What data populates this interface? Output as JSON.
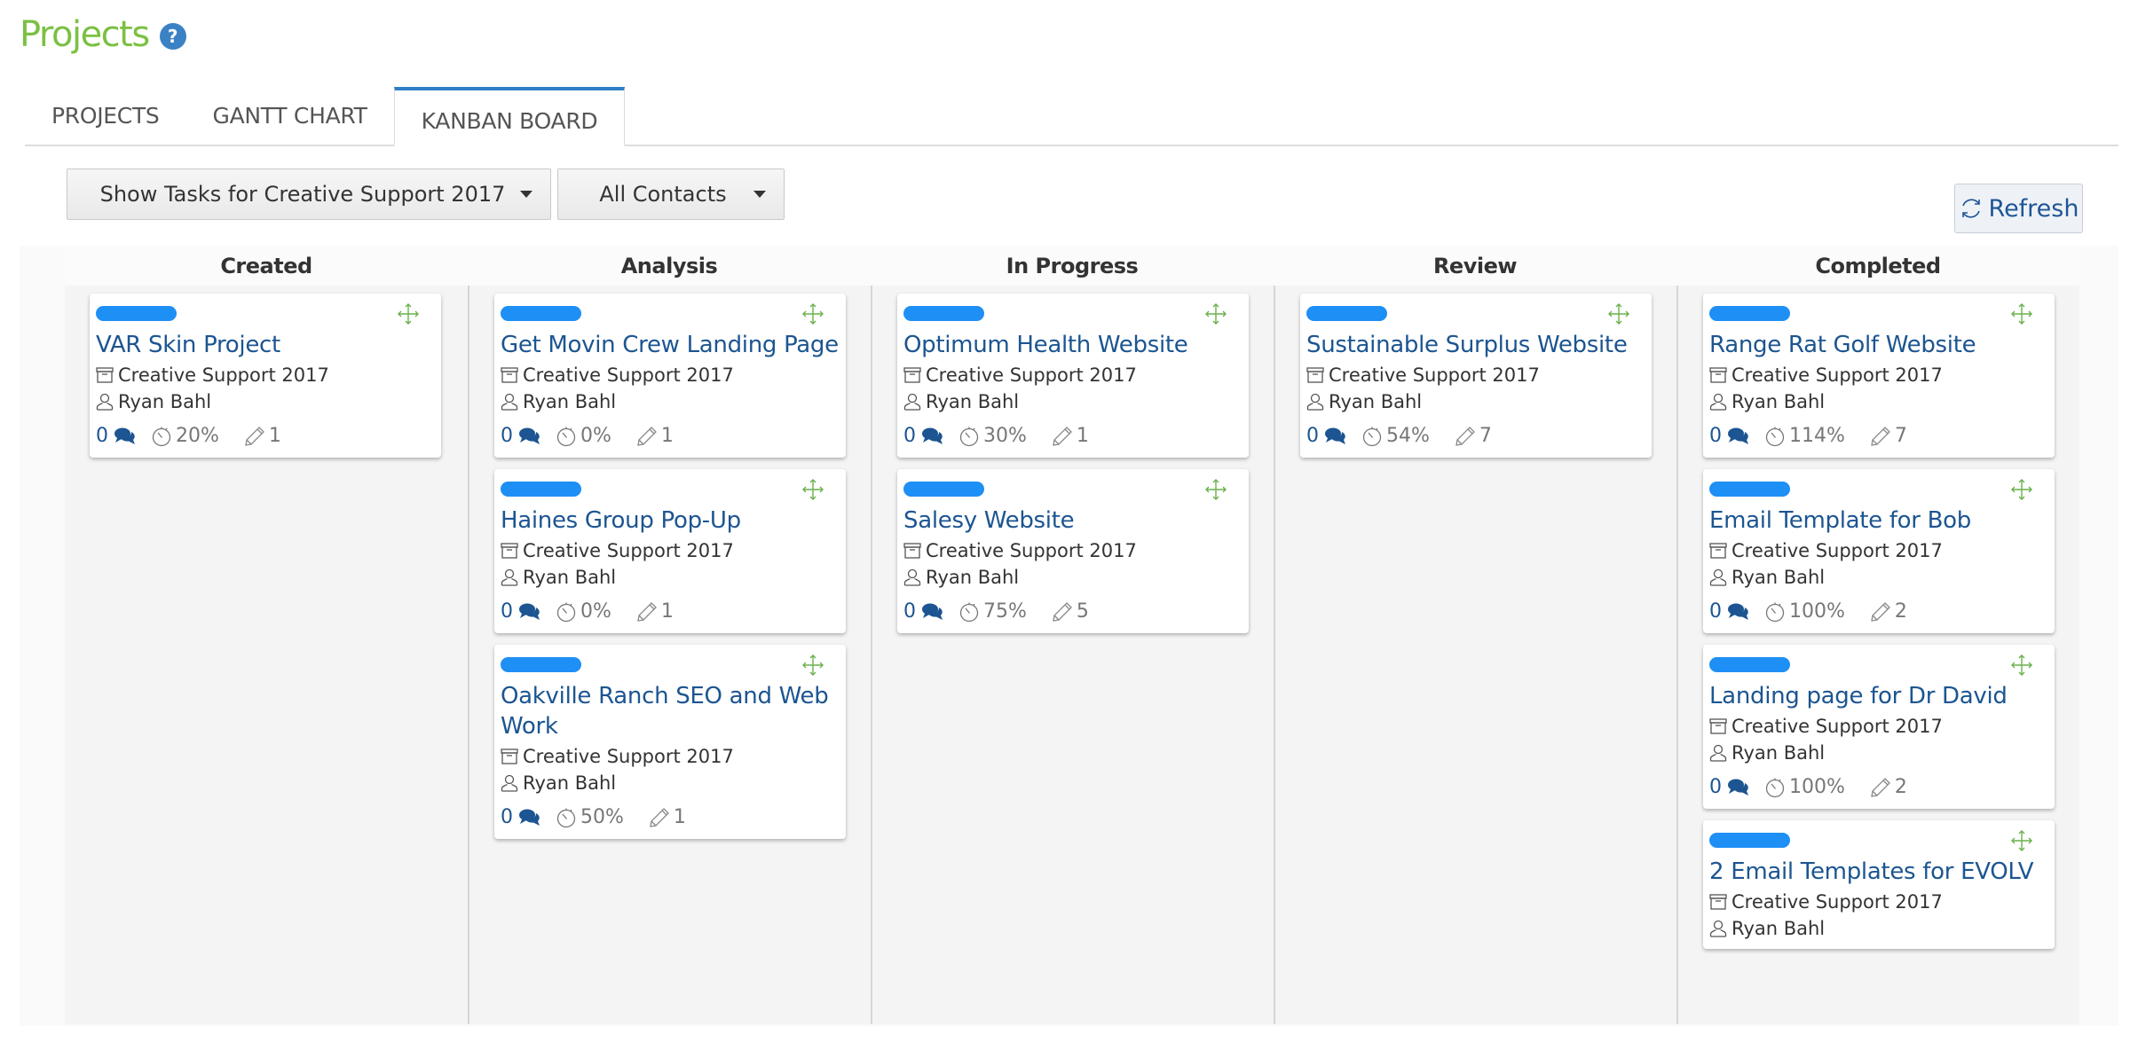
{
  "header": {
    "title": "Projects",
    "help_icon": "question-circle-icon",
    "help_glyph": "?"
  },
  "tabs": [
    {
      "label": "PROJECTS",
      "active": false
    },
    {
      "label": "GANTT CHART",
      "active": false
    },
    {
      "label": "KANBAN BOARD",
      "active": true
    }
  ],
  "filters": {
    "project_dropdown": "Show Tasks for Creative Support 2017",
    "contacts_dropdown": "All Contacts"
  },
  "toolbar": {
    "refresh_label": "Refresh",
    "refresh_icon": "refresh-icon"
  },
  "colors": {
    "title_green": "#7bc043",
    "link_blue": "#1c5591",
    "bar_blue": "#1e8ff5",
    "tab_accent": "#2f7fc6",
    "move_green": "#6ab04c"
  },
  "columns": [
    {
      "title": "Created",
      "cards": [
        {
          "title": "VAR Skin Project",
          "project": "Creative Support 2017",
          "owner": "Ryan Bahl",
          "comments": "0",
          "progress": "20%",
          "tasks": "1"
        }
      ]
    },
    {
      "title": "Analysis",
      "cards": [
        {
          "title": "Get Movin Crew Landing Page",
          "project": "Creative Support 2017",
          "owner": "Ryan Bahl",
          "comments": "0",
          "progress": "0%",
          "tasks": "1"
        },
        {
          "title": "Haines Group Pop-Up",
          "project": "Creative Support 2017",
          "owner": "Ryan Bahl",
          "comments": "0",
          "progress": "0%",
          "tasks": "1"
        },
        {
          "title": "Oakville Ranch SEO and Web Work",
          "project": "Creative Support 2017",
          "owner": "Ryan Bahl",
          "comments": "0",
          "progress": "50%",
          "tasks": "1"
        }
      ]
    },
    {
      "title": "In Progress",
      "cards": [
        {
          "title": "Optimum Health Website",
          "project": "Creative Support 2017",
          "owner": "Ryan Bahl",
          "comments": "0",
          "progress": "30%",
          "tasks": "1"
        },
        {
          "title": "Salesy Website",
          "project": "Creative Support 2017",
          "owner": "Ryan Bahl",
          "comments": "0",
          "progress": "75%",
          "tasks": "5"
        }
      ]
    },
    {
      "title": "Review",
      "cards": [
        {
          "title": "Sustainable Surplus Website",
          "project": "Creative Support 2017",
          "owner": "Ryan Bahl",
          "comments": "0",
          "progress": "54%",
          "tasks": "7"
        }
      ]
    },
    {
      "title": "Completed",
      "cards": [
        {
          "title": "Range Rat Golf Website",
          "project": "Creative Support 2017",
          "owner": "Ryan Bahl",
          "comments": "0",
          "progress": "114%",
          "tasks": "7"
        },
        {
          "title": "Email Template for Bob",
          "project": "Creative Support 2017",
          "owner": "Ryan Bahl",
          "comments": "0",
          "progress": "100%",
          "tasks": "2"
        },
        {
          "title": "Landing page for Dr David",
          "project": "Creative Support 2017",
          "owner": "Ryan Bahl",
          "comments": "0",
          "progress": "100%",
          "tasks": "2"
        },
        {
          "title": "2 Email Templates for EVOLV",
          "project": "Creative Support 2017",
          "owner": "Ryan Bahl",
          "comments": null,
          "progress": null,
          "tasks": null
        }
      ]
    }
  ]
}
